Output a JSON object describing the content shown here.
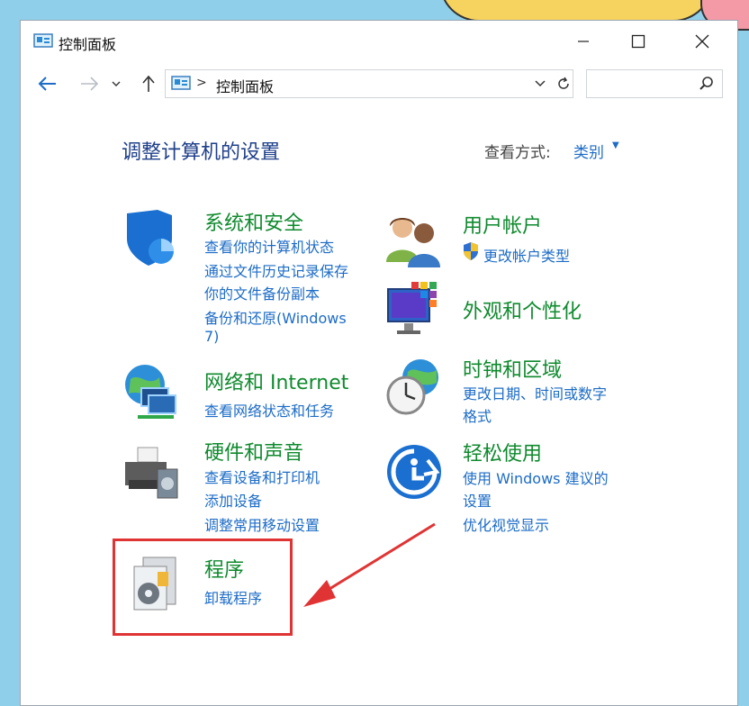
{
  "window": {
    "title": "控制面板"
  },
  "address": {
    "path": "控制面板",
    "separator": ">"
  },
  "search": {
    "placeholder": ""
  },
  "main": {
    "title": "调整计算机的设置",
    "view_by_label": "查看方式:",
    "view_by_value": "类别"
  },
  "categories": [
    {
      "title": "系统和安全",
      "icon": "shield-icon",
      "links": [
        "查看你的计算机状态",
        "通过文件历史记录保存",
        "你的文件备份副本",
        "备份和还原(Windows",
        "7)"
      ]
    },
    {
      "title": "网络和 Internet",
      "icon": "network-icon",
      "links": [
        "查看网络状态和任务"
      ]
    },
    {
      "title": "硬件和声音",
      "icon": "printer-icon",
      "links": [
        "查看设备和打印机",
        "添加设备",
        "调整常用移动设置"
      ]
    },
    {
      "title": "程序",
      "icon": "programs-icon",
      "links": [
        "卸载程序"
      ]
    },
    {
      "title": "用户帐户",
      "icon": "users-icon",
      "links": [
        "更改帐户类型"
      ]
    },
    {
      "title": "外观和个性化",
      "icon": "monitor-icon",
      "links": []
    },
    {
      "title": "时钟和区域",
      "icon": "clock-globe-icon",
      "links": [
        "更改日期、时间或数字",
        "格式"
      ]
    },
    {
      "title": "轻松使用",
      "icon": "ease-of-access-icon",
      "links": [
        "使用 Windows 建议的",
        "设置",
        "优化视觉显示"
      ]
    }
  ],
  "colors": {
    "title": "#1e3f8a",
    "category": "#0f8a2e",
    "link": "#1d6cc7",
    "highlight": "#e03434"
  }
}
